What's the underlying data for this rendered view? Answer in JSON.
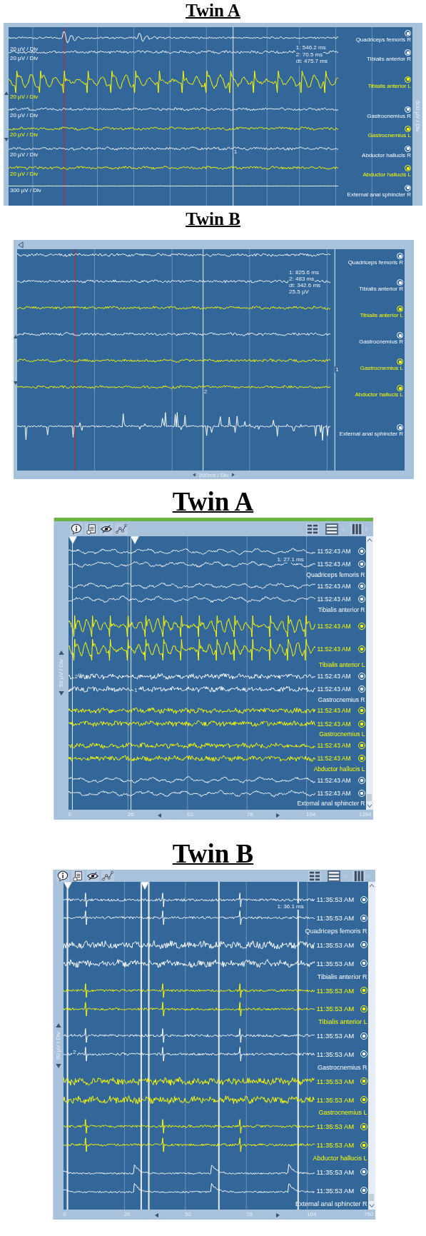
{
  "figures": [
    {
      "title": "Twin A",
      "viewer": {
        "kind": "overview",
        "side_scale": "500 µV / Div",
        "readout": [
          "1: 546.2 ms",
          "2: 70.5 ms",
          "dt: 475.7 ms"
        ],
        "cursors": [
          {
            "label": "1"
          }
        ],
        "channels": [
          {
            "name": "Quadriceps femoris R",
            "scale": "20 µV / Div",
            "color": "#ffffff",
            "kind": "burst"
          },
          {
            "name": "Tibialis anterior R",
            "scale": "20 µV / Div",
            "color": "#ffffff",
            "kind": "noise"
          },
          {
            "name": "Tibialis anterior L",
            "scale": "20 µV / Div",
            "color": "#ffff00",
            "kind": "tremor"
          },
          {
            "name": "Gastrocnemius R",
            "scale": "20 µV / Div",
            "color": "#ffffff",
            "kind": "noise"
          },
          {
            "name": "Gastrocnemius L",
            "scale": "20 µV / Div",
            "color": "#ffff00",
            "kind": "noise"
          },
          {
            "name": "Abductor hallucis R",
            "scale": "20 µV / Div",
            "color": "#ffffff",
            "kind": "noise"
          },
          {
            "name": "Abductor hallucis L",
            "scale": "20 µV / Div",
            "color": "#ffff00",
            "kind": "noise"
          },
          {
            "name": "External anal sphincter R",
            "scale": "300 µV / Div",
            "color": "#ffffff",
            "kind": "flat"
          }
        ]
      }
    },
    {
      "title": "Twin B",
      "viewer": {
        "kind": "overview",
        "time_scale": "200ms / Div",
        "readout": [
          "1: 825.6 ms",
          "2: 483 ms",
          "dt: 342.6 ms",
          "25.5 µV"
        ],
        "cursors": [
          {
            "label": "1"
          },
          {
            "label": "2"
          }
        ],
        "channels": [
          {
            "name": "Quadriceps femoris R",
            "color": "#ffffff",
            "kind": "noise"
          },
          {
            "name": "Tibialis anterior R",
            "color": "#ffffff",
            "kind": "noise"
          },
          {
            "name": "Tibialis anterior L",
            "color": "#ffff00",
            "kind": "noise"
          },
          {
            "name": "Gastrocnemius R",
            "color": "#ffffff",
            "kind": "noise"
          },
          {
            "name": "Gastrocnemius L",
            "color": "#ffff00",
            "kind": "noise"
          },
          {
            "name": "Abductor hallucis L",
            "color": "#ffff00",
            "kind": "noise"
          },
          {
            "name": "External anal sphincter R",
            "color": "#ffffff",
            "kind": "scattered"
          }
        ]
      }
    },
    {
      "title": "Twin A",
      "viewer": {
        "kind": "review",
        "green_bar": true,
        "view_buttons": [
          {
            "selected": false
          },
          {
            "selected": true
          },
          {
            "selected": false
          }
        ],
        "side_scale": "50 µV / Div",
        "readout": [
          "1: 27.1 ms"
        ],
        "cursors": [
          {
            "label": "1"
          },
          {
            "label": "2"
          }
        ],
        "ticks": [
          "0",
          "26",
          "52",
          "78",
          "104",
          "1394"
        ],
        "channels": [
          {
            "name": "Quadriceps femoris R",
            "color": "#ffffff",
            "kind": "wavy",
            "times": [
              "11:52:43 AM",
              "11:52:43 AM"
            ]
          },
          {
            "name": "Tibialis anterior R",
            "color": "#ffffff",
            "kind": "wavy",
            "times": [
              "11:52:43 AM",
              "11:52:43 AM"
            ]
          },
          {
            "name": "Tibialis anterior L",
            "color": "#ffff00",
            "kind": "tremor",
            "times": [
              "11:52:43 AM",
              "11:52:43 AM"
            ]
          },
          {
            "name": "Gastrocnemius R",
            "color": "#ffffff",
            "kind": "noise",
            "times": [
              "11:52:43 AM",
              "11:52:43 AM"
            ]
          },
          {
            "name": "Gastrocnemius L",
            "color": "#ffff00",
            "kind": "noise",
            "times": [
              "11:52:43 AM",
              "11:52:43 AM"
            ]
          },
          {
            "name": "Abductor hallucis L",
            "color": "#ffff00",
            "kind": "noise",
            "times": [
              "11:52:43 AM",
              "11:52:43 AM"
            ]
          },
          {
            "name": "External anal sphincter R",
            "color": "#ffffff",
            "kind": "wavy",
            "times": [
              "11:52:43 AM",
              "11:52:43 AM"
            ]
          }
        ]
      }
    },
    {
      "title": "Twin B",
      "viewer": {
        "kind": "review",
        "green_bar": false,
        "view_buttons": [
          {
            "selected": false
          },
          {
            "selected": true
          },
          {
            "selected": false
          }
        ],
        "side_scale": "50 µV / Div",
        "readout": [
          "1: 36.1 ms"
        ],
        "cursors": [
          {
            "label": "2"
          }
        ],
        "ticks": [
          "0",
          "26",
          "52",
          "78",
          "104",
          "760"
        ],
        "channels": [
          {
            "name": "Quadriceps femoris R",
            "color": "#ffffff",
            "kind": "spike",
            "times": [
              "11:35:53 AM",
              "11:35:53 AM"
            ]
          },
          {
            "name": "Tibialis anterior R",
            "color": "#ffffff",
            "kind": "noise",
            "times": [
              "11:35:53 AM",
              "11:35:53 AM"
            ]
          },
          {
            "name": "Tibialis anterior L",
            "color": "#ffff00",
            "kind": "spike",
            "times": [
              "11:35:53 AM",
              "11:35:53 AM"
            ]
          },
          {
            "name": "Gastrocnemius R",
            "color": "#ffffff",
            "kind": "spike",
            "times": [
              "11:35:53 AM",
              "11:35:53 AM"
            ]
          },
          {
            "name": "Gastrocnemius L",
            "color": "#ffff00",
            "kind": "noise",
            "times": [
              "11:35:53 AM",
              "11:35:53 AM"
            ]
          },
          {
            "name": "Abductor hallucis L",
            "color": "#ffff00",
            "kind": "spike",
            "times": [
              "11:35:53 AM",
              "11:35:53 AM"
            ]
          },
          {
            "name": "External anal sphincter R",
            "color": "#ffffff",
            "kind": "decay",
            "times": [
              "11:35:53 AM",
              "11:35:53 AM"
            ]
          }
        ]
      }
    }
  ]
}
